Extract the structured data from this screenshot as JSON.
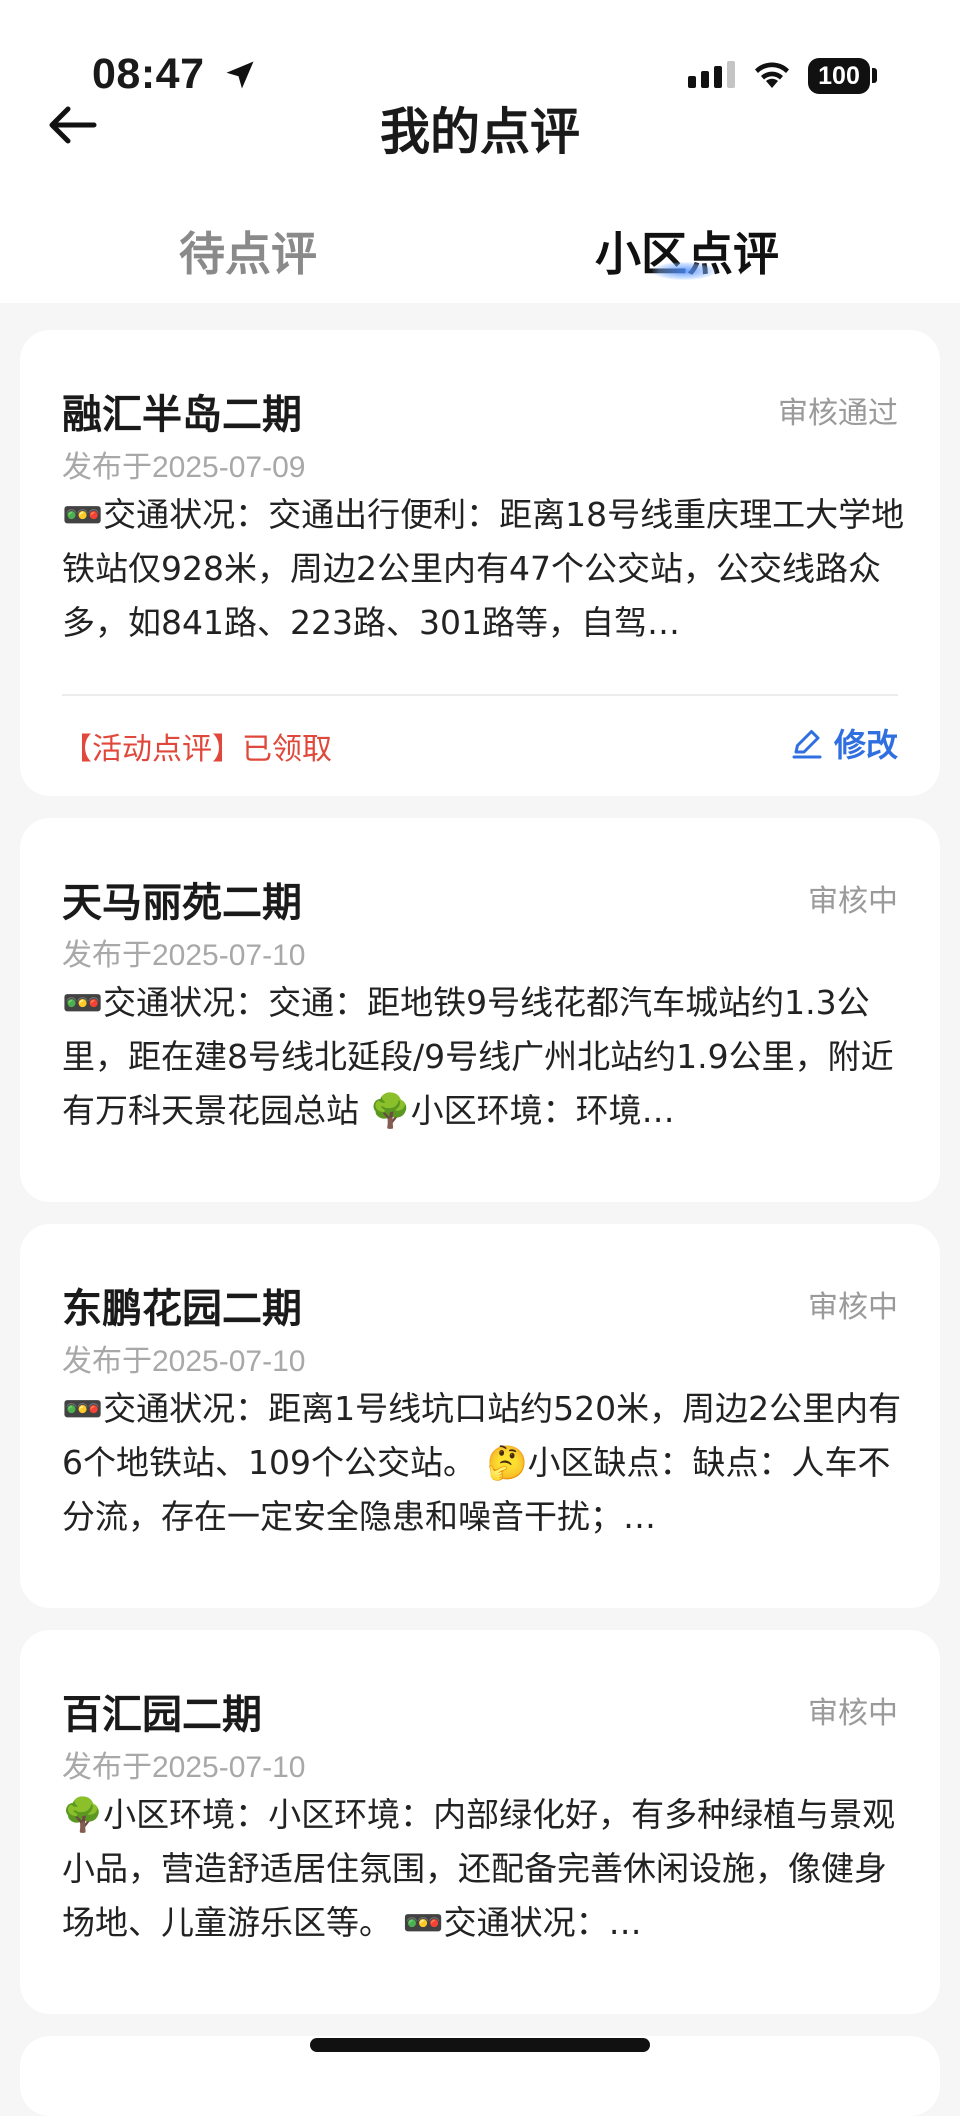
{
  "status_bar": {
    "time": "08:47",
    "battery": "100"
  },
  "header": {
    "title": "我的点评"
  },
  "tabs": [
    {
      "label": "待点评",
      "active": false
    },
    {
      "label": "小区点评",
      "active": true
    }
  ],
  "colors": {
    "accent": "#2f6fe0",
    "activity": "#e0483b",
    "muted": "#9a9a9a"
  },
  "reviews": [
    {
      "name": "融汇半岛二期",
      "status": "审核通过",
      "date": "发布于2025-07-09",
      "content": "🚥交通状况：交通出行便利：距离18号线重庆理工大学地铁站仅928米，周边2公里内有47个公交站，公交线路众多，如841路、223路、301路等，自驾…",
      "activity_note": "【活动点评】已领取",
      "edit_label": "修改"
    },
    {
      "name": "天马丽苑二期",
      "status": "审核中",
      "date": "发布于2025-07-10",
      "content": "🚥交通状况：交通：距地铁9号线花都汽车城站约1.3公里，距在建8号线北延段/9号线广州北站约1.9公里，附近有万科天景花园总站 🌳小区环境：环境…"
    },
    {
      "name": "东鹏花园二期",
      "status": "审核中",
      "date": "发布于2025-07-10",
      "content": "🚥交通状况：距离1号线坑口站约520米，周边2公里内有6个地铁站、109个公交站。 🤔小区缺点：缺点：人车不分流，存在一定安全隐患和噪音干扰；…"
    },
    {
      "name": "百汇园二期",
      "status": "审核中",
      "date": "发布于2025-07-10",
      "content": "🌳小区环境：小区环境：内部绿化好，有多种绿植与景观小品，营造舒适居住氛围，还配备完善休闲设施，像健身场地、儿童游乐区等。 🚥交通状况：…"
    }
  ]
}
